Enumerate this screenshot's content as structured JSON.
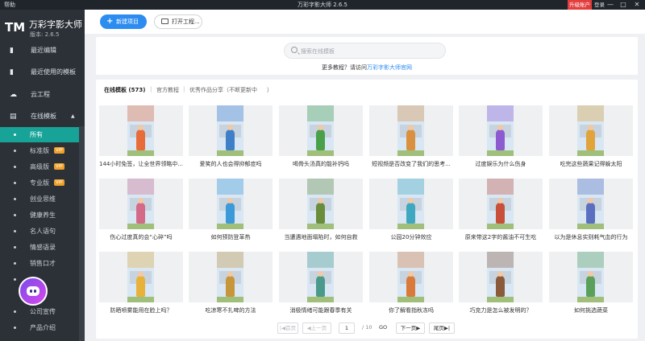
{
  "titlebar": {
    "menu_help": "帮助",
    "title": "万彩字影大师 2.6.5",
    "upgrade": "升级账户",
    "login": "登录",
    "min": "—",
    "max": "□",
    "close": "✕"
  },
  "brand": {
    "logo": "TM",
    "name": "万彩字影大师",
    "version": "版本: 2.6.5"
  },
  "nav": [
    {
      "label": "最近编辑",
      "icon": "file-icon"
    },
    {
      "label": "最近使用的模板",
      "icon": "file-icon"
    },
    {
      "label": "云工程",
      "icon": "cloud-icon"
    },
    {
      "label": "在线模板",
      "icon": "template-icon"
    }
  ],
  "sub_items": [
    {
      "label": "所有",
      "vip": ""
    },
    {
      "label": "标准版",
      "vip": "VIP"
    },
    {
      "label": "高级版",
      "vip": "VIP"
    },
    {
      "label": "专业版",
      "vip": "VIP"
    },
    {
      "label": "创业思维",
      "vip": ""
    },
    {
      "label": "健康养生",
      "vip": ""
    },
    {
      "label": "名人语句",
      "vip": ""
    },
    {
      "label": "情感语录",
      "vip": ""
    },
    {
      "label": "销售口才",
      "vip": ""
    },
    {
      "label": "",
      "vip": ""
    },
    {
      "label": "公司宣传",
      "vip": ""
    },
    {
      "label": "产品介绍",
      "vip": ""
    }
  ],
  "toolbar": {
    "new_project": "新建项目",
    "open_project": "打开工程..."
  },
  "search": {
    "placeholder": "搜索在线模板"
  },
  "tip": {
    "text": "更多教程？请访问",
    "link": "万彩字影大师官网"
  },
  "tabs": {
    "online": "在线模板 (573)",
    "official": "官方教程",
    "share": "优秀作品分享（不断更新中",
    "share_tail": "）"
  },
  "cards": [
    {
      "caption": "144小时免签，让全世界领略中...",
      "color": "#e86b3a"
    },
    {
      "caption": "爱笑的人也会得抑郁症吗",
      "color": "#3f7fc8"
    },
    {
      "caption": "喝骨头汤真的能补钙吗",
      "color": "#4aa04a"
    },
    {
      "caption": "短视频是否改变了我们的思考...",
      "color": "#d9903f"
    },
    {
      "caption": "过度娱乐为什么伤身",
      "color": "#8c5bd0"
    },
    {
      "caption": "吃完这些蔬果记得躲太阳",
      "color": "#e0a43a"
    },
    {
      "caption": "伤心过度真的会“心碎”吗",
      "color": "#d46a88"
    },
    {
      "caption": "如何预防登革热",
      "color": "#3c9ad8"
    },
    {
      "caption": "当遭遇地面塌陷时，如何自救",
      "color": "#6a8d3c"
    },
    {
      "caption": "公园20分钟效应",
      "color": "#3fa8c0"
    },
    {
      "caption": "原来带这2字的酱油不可生吃",
      "color": "#c8503a"
    },
    {
      "caption": "以为是休息实则耗气血的行为",
      "color": "#5a6fc0"
    },
    {
      "caption": "防晒喷雾能用在脸上吗？",
      "color": "#e8b13a"
    },
    {
      "caption": "吃凉寒不扎啤的方法",
      "color": "#c8963a"
    },
    {
      "caption": "消极情绪可能跟春季有关",
      "color": "#4a9a8c"
    },
    {
      "caption": "你了解看指秋冻吗",
      "color": "#d97a3a"
    },
    {
      "caption": "巧克力是怎么被发明的？",
      "color": "#8a5a3a"
    },
    {
      "caption": "如何挑选蔬菜",
      "color": "#5aa05a"
    }
  ],
  "pager": {
    "first": "|◀首页",
    "prev": "◀上一页",
    "current": "1",
    "total": "/ 10",
    "go": "GO",
    "next": "下一页▶",
    "last": "尾页▶|"
  }
}
